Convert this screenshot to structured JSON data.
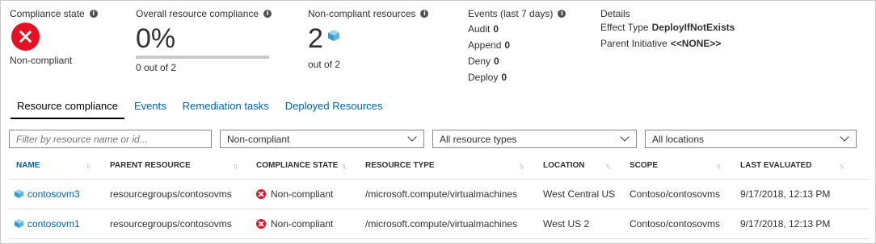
{
  "summary": {
    "compliance_state": {
      "title": "Compliance state",
      "value": "Non-compliant"
    },
    "overall": {
      "title": "Overall resource compliance",
      "value": "0%",
      "detail": "0 out of 2",
      "progress": 0
    },
    "noncompliant": {
      "title": "Non-compliant resources",
      "value": "2",
      "detail": "out of 2"
    },
    "events": {
      "title": "Events (last 7 days)",
      "items": [
        {
          "label": "Audit",
          "count": "0"
        },
        {
          "label": "Append",
          "count": "0"
        },
        {
          "label": "Deny",
          "count": "0"
        },
        {
          "label": "Deploy",
          "count": "0"
        }
      ]
    },
    "details": {
      "title": "Details",
      "effect_label": "Effect Type",
      "effect_value": "DeployIfNotExists",
      "initiative_label": "Parent Initiative",
      "initiative_value": "<<NONE>>"
    }
  },
  "tabs": [
    "Resource compliance",
    "Events",
    "Remediation tasks",
    "Deployed Resources"
  ],
  "filters": {
    "search_placeholder": "Filter by resource name or id...",
    "compliance": "Non-compliant",
    "types": "All resource types",
    "locations": "All locations"
  },
  "table": {
    "columns": [
      "Name",
      "Parent resource",
      "Compliance state",
      "Resource type",
      "Location",
      "Scope",
      "Last evaluated"
    ],
    "rows": [
      {
        "name": "contosovm3",
        "parent": "resourcegroups/contosovms",
        "state": "Non-compliant",
        "type": "/microsoft.compute/virtualmachines",
        "location": "West Central US",
        "scope": "Contoso/contosovms",
        "evaluated": "9/17/2018, 12:13 PM"
      },
      {
        "name": "contosovm1",
        "parent": "resourcegroups/contosovms",
        "state": "Non-compliant",
        "type": "/microsoft.compute/virtualmachines",
        "location": "West US 2",
        "scope": "Contoso/contosovms",
        "evaluated": "9/17/2018, 12:13 PM"
      }
    ]
  },
  "colors": {
    "accent": "#0062ad",
    "error": "#e81123",
    "cube": "#59b4d9"
  },
  "icons": [
    "info-icon",
    "error-circle-icon",
    "cube-icon",
    "sort-arrows-icon",
    "chevron-down-icon"
  ]
}
